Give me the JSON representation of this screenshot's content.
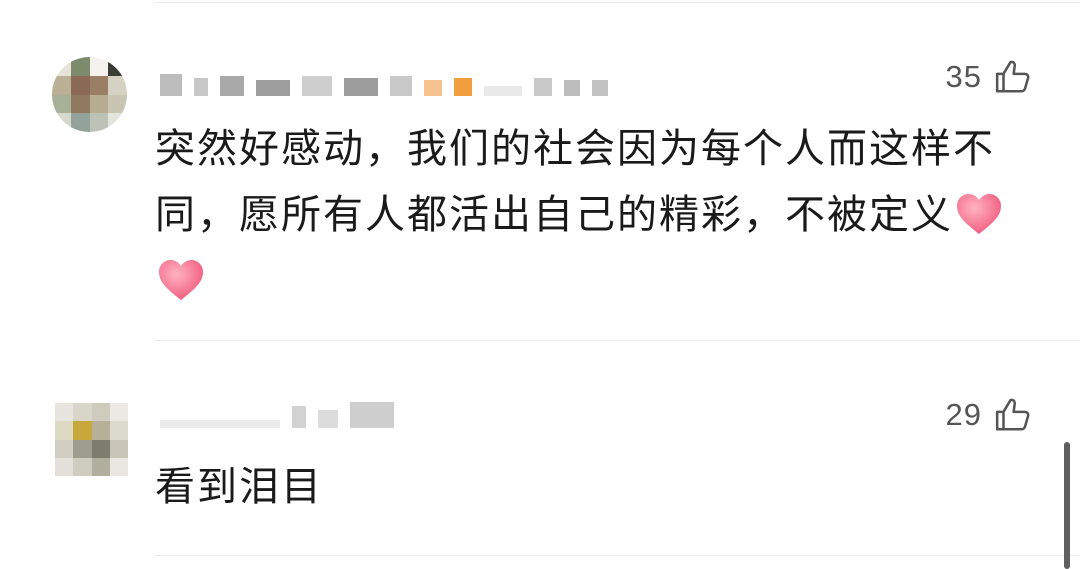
{
  "comments": [
    {
      "likes": "35",
      "text": "突然好感动，我们的社会因为每个人而这样不同，愿所有人都活出自己的精彩，不被定义"
    },
    {
      "likes": "29",
      "text": "看到泪目"
    }
  ],
  "icons": {
    "like": "thumbs-up-icon",
    "heart": "heart-emoji-icon"
  },
  "colors": {
    "text": "#1a1a1a",
    "count": "#555555",
    "heart": "#f46a8a"
  }
}
